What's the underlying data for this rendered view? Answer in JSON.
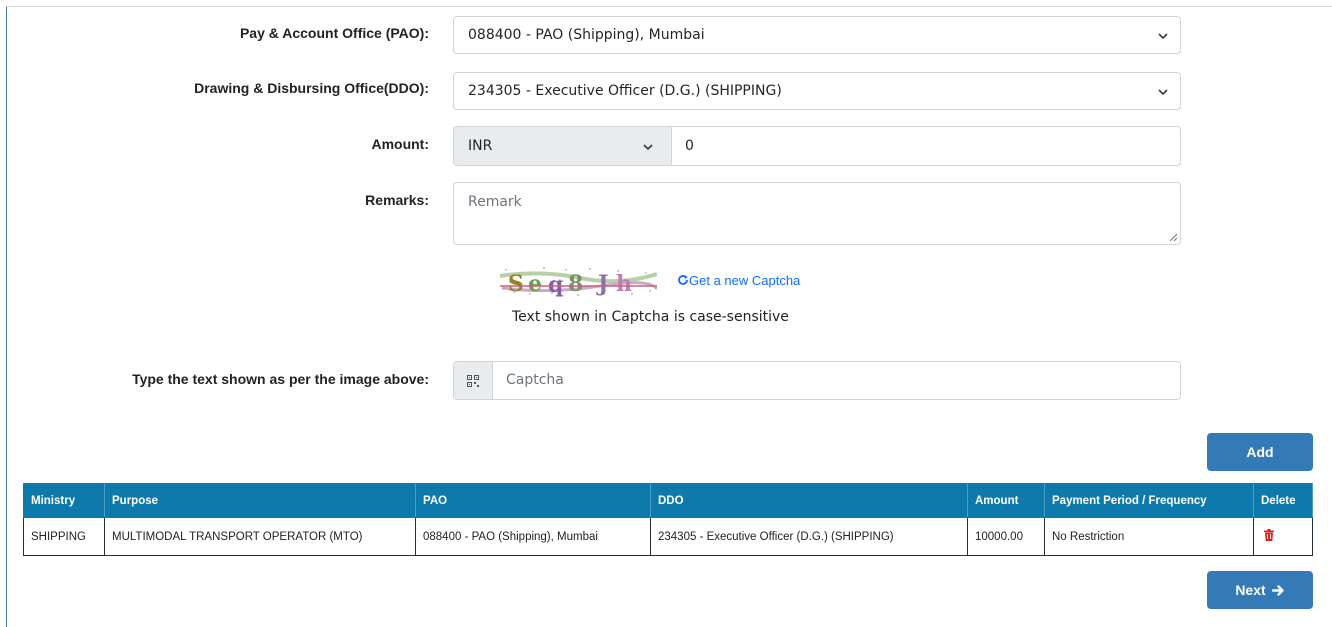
{
  "form": {
    "pao": {
      "label": "Pay & Account Office (PAO):",
      "value": "088400 - PAO (Shipping), Mumbai"
    },
    "ddo": {
      "label": "Drawing & Disbursing Office(DDO):",
      "value": "234305 - Executive Officer (D.G.) (SHIPPING)"
    },
    "amount": {
      "label": "Amount:",
      "currency": "INR",
      "value": "0"
    },
    "remarks": {
      "label": "Remarks:",
      "placeholder": "Remark"
    },
    "captcha": {
      "image_text": "Seq8Jh",
      "refresh_label": "Get a new Captcha",
      "note": "Text shown in Captcha is case-sensitive",
      "input_label": "Type the text shown as per the image above:",
      "input_placeholder": "Captcha"
    }
  },
  "buttons": {
    "add": "Add",
    "next": "Next"
  },
  "table": {
    "headers": [
      "Ministry",
      "Purpose",
      "PAO",
      "DDO",
      "Amount",
      "Payment Period / Frequency",
      "Delete"
    ],
    "rows": [
      {
        "ministry": "SHIPPING",
        "purpose": "MULTIMODAL TRANSPORT OPERATOR (MTO)",
        "pao": "088400 - PAO (Shipping), Mumbai",
        "ddo": "234305 - Executive Officer (D.G.) (SHIPPING)",
        "amount": "10000.00",
        "frequency": "No Restriction"
      }
    ]
  },
  "icons": {
    "refresh": "refresh-icon",
    "qr": "qrcode-icon",
    "delete": "trash-icon",
    "next": "arrow-right-icon"
  },
  "colors": {
    "primary_button": "#337ab7",
    "table_header": "#0e7aac",
    "delete_icon": "#d9231f",
    "link": "#0d6efd"
  }
}
